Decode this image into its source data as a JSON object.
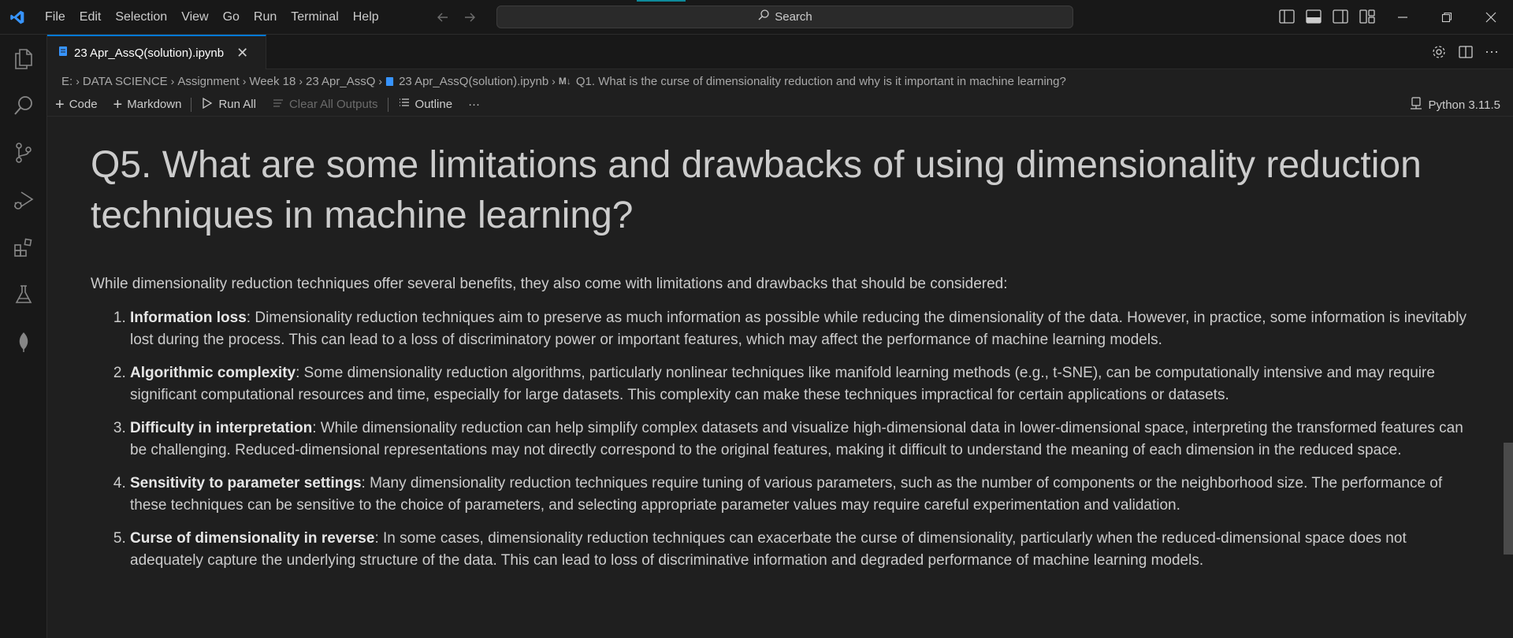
{
  "titlebar": {
    "menu": [
      "File",
      "Edit",
      "Selection",
      "View",
      "Go",
      "Run",
      "Terminal",
      "Help"
    ],
    "search_placeholder": "Search"
  },
  "tab": {
    "label": "23 Apr_AssQ(solution).ipynb",
    "close": "✕"
  },
  "breadcrumb": {
    "items": [
      "E:",
      "DATA SCIENCE",
      "Assignment",
      "Week 18",
      "23 Apr_AssQ",
      "23 Apr_AssQ(solution).ipynb",
      "Q1. What is the curse of dimensionality reduction and why is it important in machine learning?"
    ],
    "md_icon": "M↓"
  },
  "toolbar": {
    "code": "Code",
    "markdown": "Markdown",
    "run_all": "Run All",
    "clear_outputs": "Clear All Outputs",
    "outline": "Outline",
    "more": "···",
    "kernel": "Python 3.11.5"
  },
  "cell": {
    "heading": "Q5. What are some limitations and drawbacks of using dimensionality reduction techniques in machine learning?",
    "intro": "While dimensionality reduction techniques offer several benefits, they also come with limitations and drawbacks that should be considered:",
    "items": [
      {
        "term": "Information loss",
        "text": ": Dimensionality reduction techniques aim to preserve as much information as possible while reducing the dimensionality of the data. However, in practice, some information is inevitably lost during the process. This can lead to a loss of discriminatory power or important features, which may affect the performance of machine learning models."
      },
      {
        "term": "Algorithmic complexity",
        "text": ": Some dimensionality reduction algorithms, particularly nonlinear techniques like manifold learning methods (e.g., t-SNE), can be computationally intensive and may require significant computational resources and time, especially for large datasets. This complexity can make these techniques impractical for certain applications or datasets."
      },
      {
        "term": "Difficulty in interpretation",
        "text": ": While dimensionality reduction can help simplify complex datasets and visualize high-dimensional data in lower-dimensional space, interpreting the transformed features can be challenging. Reduced-dimensional representations may not directly correspond to the original features, making it difficult to understand the meaning of each dimension in the reduced space."
      },
      {
        "term": "Sensitivity to parameter settings",
        "text": ": Many dimensionality reduction techniques require tuning of various parameters, such as the number of components or the neighborhood size. The performance of these techniques can be sensitive to the choice of parameters, and selecting appropriate parameter values may require careful experimentation and validation."
      },
      {
        "term": "Curse of dimensionality in reverse",
        "text": ": In some cases, dimensionality reduction techniques can exacerbate the curse of dimensionality, particularly when the reduced-dimensional space does not adequately capture the underlying structure of the data. This can lead to loss of discriminative information and degraded performance of machine learning models."
      }
    ]
  },
  "colors": {
    "accent": "#0078d4",
    "vscode_blue": "#3794ff",
    "background": "#1f1f1f",
    "chrome": "#181818"
  }
}
